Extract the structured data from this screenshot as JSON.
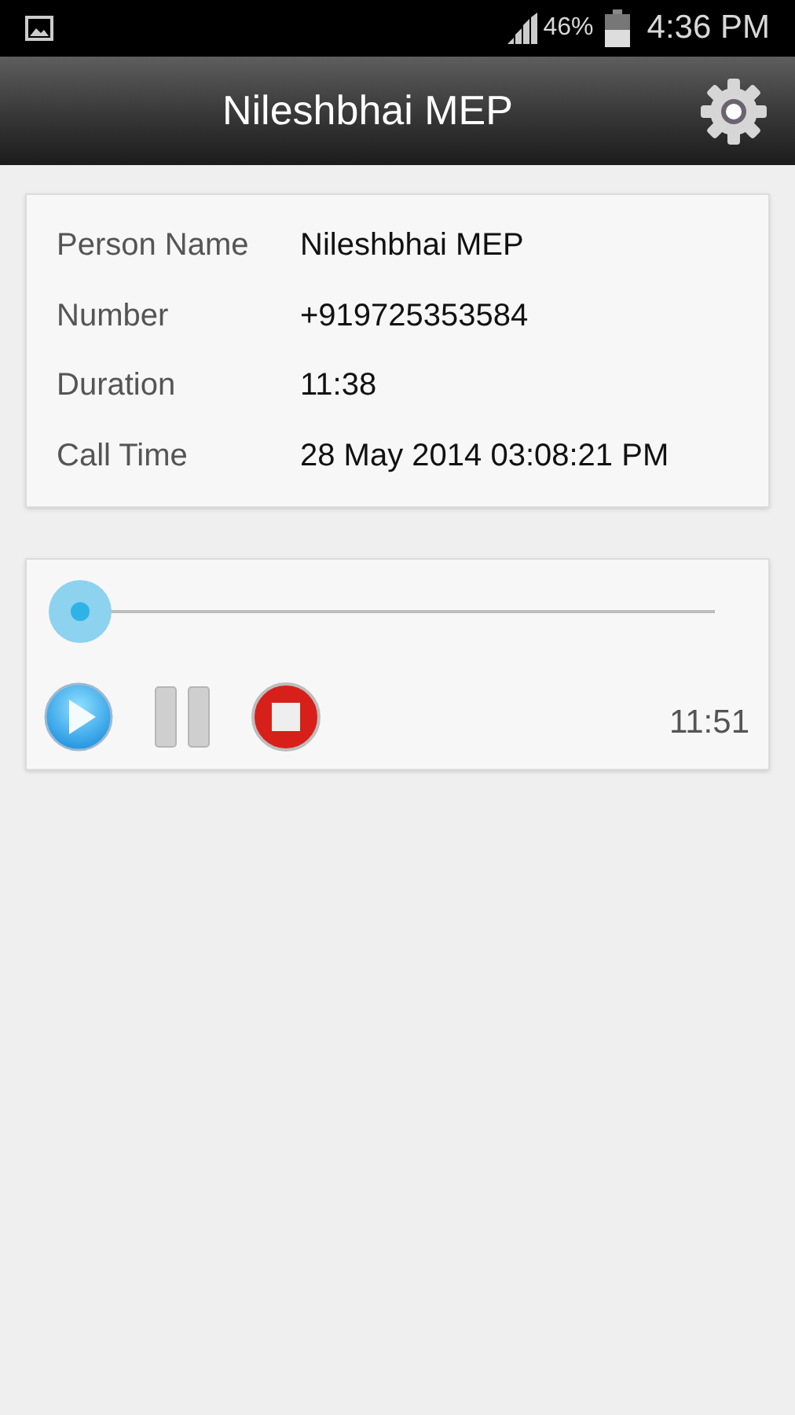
{
  "status_bar": {
    "battery": "46%",
    "time": "4:36 PM"
  },
  "title": "Nileshbhai MEP",
  "details": [
    {
      "label": "Person Name",
      "value": "Nileshbhai MEP"
    },
    {
      "label": "Number",
      "value": "+919725353584"
    },
    {
      "label": "Duration",
      "value": "11:38"
    },
    {
      "label": "Call Time",
      "value": "28 May 2014 03:08:21 PM"
    }
  ],
  "player": {
    "total": "11:51"
  }
}
